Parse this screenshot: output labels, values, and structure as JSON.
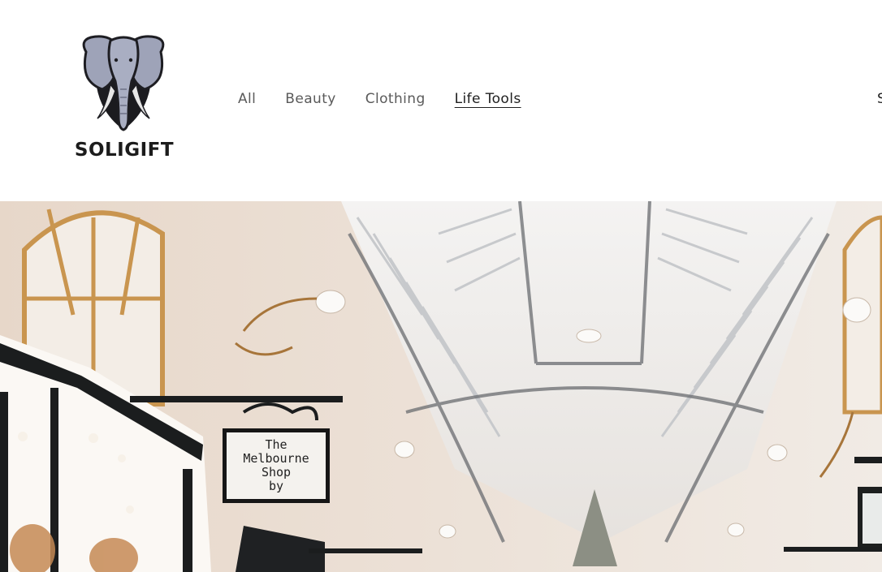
{
  "brand": {
    "name": "SOLIGIFT",
    "logo_icon": "elephant-shield-icon"
  },
  "nav": {
    "items": [
      {
        "label": "All"
      },
      {
        "label": "Beauty"
      },
      {
        "label": "Clothing"
      },
      {
        "label": "Life Tools",
        "active": true
      }
    ]
  },
  "header_edge_text": "S",
  "hero": {
    "sign_lines": [
      "The",
      "Melbourne",
      "Shop",
      "by"
    ]
  }
}
